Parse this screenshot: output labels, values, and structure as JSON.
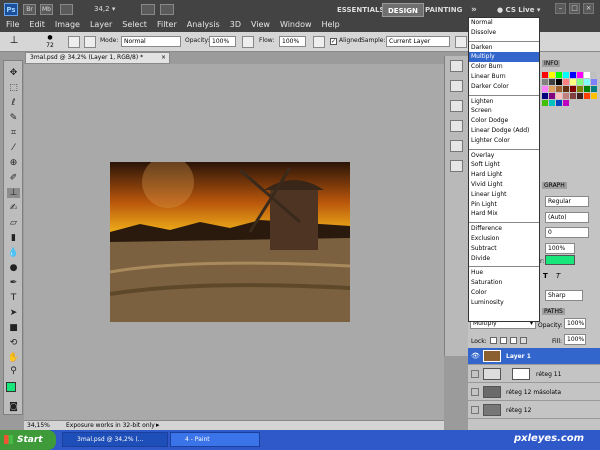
{
  "menubar": {
    "logo": "Ps",
    "menus": [
      "File",
      "Edit",
      "Image",
      "Layer",
      "Select",
      "Filter",
      "Analysis",
      "3D",
      "View",
      "Window",
      "Help"
    ],
    "zoom_value": "34,2",
    "workspaces": [
      "ESSENTIALS",
      "DESIGN",
      "PAINTING"
    ],
    "more": "»",
    "cslive": "CS Live"
  },
  "options_bar": {
    "brush_size": "72",
    "mode_label": "Mode:",
    "mode_value": "Normal",
    "opacity_label": "Opacity:",
    "opacity_value": "100%",
    "flow_label": "Flow:",
    "flow_value": "100%",
    "aligned_label": "Aligned",
    "sample_label": "Sample:",
    "sample_value": "Current Layer"
  },
  "document": {
    "tab_label": "3mal.psd @ 34,2% (Layer 1, RGB/8) *",
    "zoom": "34,15%",
    "status_text": "Exposure works in 32-bit only"
  },
  "blend_modes": [
    [
      "Normal",
      "Dissolve"
    ],
    [
      "Darken",
      "Multiply",
      "Color Burn",
      "Linear Burn",
      "Darker Color"
    ],
    [
      "Lighten",
      "Screen",
      "Color Dodge",
      "Linear Dodge (Add)",
      "Lighter Color"
    ],
    [
      "Overlay",
      "Soft Light",
      "Hard Light",
      "Vivid Light",
      "Linear Light",
      "Pin Light",
      "Hard Mix"
    ],
    [
      "Difference",
      "Exclusion",
      "Subtract",
      "Divide"
    ],
    [
      "Hue",
      "Saturation",
      "Color",
      "Luminosity"
    ]
  ],
  "selected_blend": "Multiply",
  "character_panel": {
    "tab": "GRAPH",
    "style": "Regular",
    "leading": "(Auto)",
    "tracking": "0",
    "scale": "100%",
    "color_label": "r:",
    "aa": "Sharp"
  },
  "swatches_tab": "INFO",
  "layers_panel": {
    "tab": "PATHS",
    "blend_value": "Multiply",
    "opacity_label": "Opacity:",
    "opacity_value": "100%",
    "lock_label": "Lock:",
    "fill_label": "Fill:",
    "fill_value": "100%",
    "layers": [
      {
        "name": "Layer 1"
      },
      {
        "name": "réteg 11"
      },
      {
        "name": "réteg 12 másolata"
      },
      {
        "name": "réteg 12"
      }
    ]
  },
  "taskbar": {
    "start": "Start",
    "tasks": [
      "3mal.psd @ 34,2% (...",
      "4 - Paint"
    ],
    "watermark": "pxleyes.com"
  },
  "colors": {
    "foreground": "#19e67a",
    "accent": "#3366cc"
  }
}
